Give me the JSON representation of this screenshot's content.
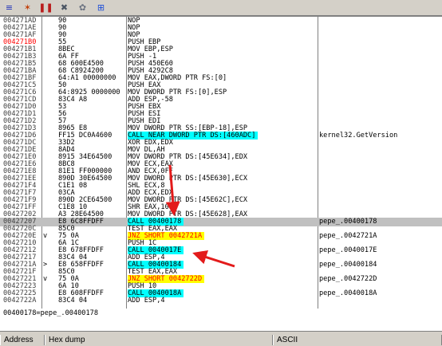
{
  "toolbar": {
    "icons": [
      {
        "name": "list-icon",
        "glyph": "≡",
        "color": "#1d2fb8"
      },
      {
        "name": "flame-icon",
        "glyph": "✶",
        "color": "#c2410c"
      },
      {
        "name": "bars-icon",
        "glyph": "❚❚",
        "color": "#b91c1c"
      },
      {
        "name": "crossed-tools-icon",
        "glyph": "✖",
        "color": "#4b5563"
      },
      {
        "name": "gear-icon",
        "glyph": "✿",
        "color": "#6b7280"
      },
      {
        "name": "network-icon",
        "glyph": "⊞",
        "color": "#1d4ed8"
      }
    ]
  },
  "disasm": {
    "rows": [
      {
        "addr": "004271AD",
        "hex": "90",
        "asm": "NOP",
        "comment": ""
      },
      {
        "addr": "004271AE",
        "hex": "90",
        "asm": "NOP",
        "comment": ""
      },
      {
        "addr": "004271AF",
        "hex": "90",
        "asm": "NOP",
        "comment": ""
      },
      {
        "addr": "004271B0",
        "hex": "55",
        "asm": "PUSH EBP",
        "comment": "",
        "addr_color": "red"
      },
      {
        "addr": "004271B1",
        "hex": "8BEC",
        "asm": "MOV EBP,ESP",
        "comment": ""
      },
      {
        "addr": "004271B3",
        "hex": "6A FF",
        "asm": "PUSH -1",
        "comment": ""
      },
      {
        "addr": "004271B5",
        "hex": "68 600E4500",
        "asm": "PUSH 450E60",
        "comment": ""
      },
      {
        "addr": "004271BA",
        "hex": "68 C8924200",
        "asm": "PUSH 4292C8",
        "comment": ""
      },
      {
        "addr": "004271BF",
        "hex": "64:A1 00000000",
        "asm": "MOV EAX,DWORD PTR FS:[0]",
        "comment": ""
      },
      {
        "addr": "004271C5",
        "hex": "50",
        "asm": "PUSH EAX",
        "comment": ""
      },
      {
        "addr": "004271C6",
        "hex": "64:8925 0000000",
        "asm": "MOV DWORD PTR FS:[0],ESP",
        "comment": ""
      },
      {
        "addr": "004271CD",
        "hex": "83C4 A8",
        "asm": "ADD ESP,-58",
        "comment": ""
      },
      {
        "addr": "004271D0",
        "hex": "53",
        "asm": "PUSH EBX",
        "comment": ""
      },
      {
        "addr": "004271D1",
        "hex": "56",
        "asm": "PUSH ESI",
        "comment": ""
      },
      {
        "addr": "004271D2",
        "hex": "57",
        "asm": "PUSH EDI",
        "comment": ""
      },
      {
        "addr": "004271D3",
        "hex": "8965 E8",
        "asm": "MOV DWORD PTR SS:[EBP-18],ESP",
        "comment": ""
      },
      {
        "addr": "004271D6",
        "hex": "FF15 DC0A4600",
        "asm": "CALL NEAR DWORD PTR DS:[460ADC]",
        "comment": "kernel32.GetVersion",
        "kind": "call"
      },
      {
        "addr": "004271DC",
        "hex": "33D2",
        "asm": "XOR EDX,EDX",
        "comment": ""
      },
      {
        "addr": "004271DE",
        "hex": "8AD4",
        "asm": "MOV DL,AH",
        "comment": ""
      },
      {
        "addr": "004271E0",
        "hex": "8915 34E64500",
        "asm": "MOV DWORD PTR DS:[45E634],EDX",
        "comment": ""
      },
      {
        "addr": "004271E6",
        "hex": "8BC8",
        "asm": "MOV ECX,EAX",
        "comment": ""
      },
      {
        "addr": "004271E8",
        "hex": "81E1 FF000000",
        "asm": "AND ECX,0FF",
        "comment": ""
      },
      {
        "addr": "004271EE",
        "hex": "890D 30E64500",
        "asm": "MOV DWORD PTR DS:[45E630],ECX",
        "comment": ""
      },
      {
        "addr": "004271F4",
        "hex": "C1E1 08",
        "asm": "SHL ECX,8",
        "comment": ""
      },
      {
        "addr": "004271F7",
        "hex": "03CA",
        "asm": "ADD ECX,EDX",
        "comment": ""
      },
      {
        "addr": "004271F9",
        "hex": "890D 2CE64500",
        "asm": "MOV DWORD PTR DS:[45E62C],ECX",
        "comment": ""
      },
      {
        "addr": "004271FF",
        "hex": "C1E8 10",
        "asm": "SHR EAX,10",
        "comment": ""
      },
      {
        "addr": "00427202",
        "hex": "A3 28E64500",
        "asm": "MOV DWORD PTR DS:[45E628],EAX",
        "comment": ""
      },
      {
        "addr": "00427207",
        "hex": "E8 6C8FFDFF",
        "asm": "CALL 00400178",
        "comment": "pepe_.00400178",
        "kind": "call",
        "selected": true
      },
      {
        "addr": "0042720C",
        "hex": "85C0",
        "asm": "TEST EAX,EAX",
        "comment": ""
      },
      {
        "addr": "0042720E",
        "hex": "75 0A",
        "asm": "JNZ SHORT 0042721A",
        "comment": "pepe_.0042721A",
        "kind": "jmp",
        "tick": "v"
      },
      {
        "addr": "00427210",
        "hex": "6A 1C",
        "asm": "PUSH 1C",
        "comment": ""
      },
      {
        "addr": "00427212",
        "hex": "E8 678FFDFF",
        "asm": "CALL 0040017E",
        "comment": "pepe_.0040017E",
        "kind": "call"
      },
      {
        "addr": "00427217",
        "hex": "83C4 04",
        "asm": "ADD ESP,4",
        "comment": ""
      },
      {
        "addr": "0042721A",
        "hex": "E8 658FFDFF",
        "asm": "CALL 00400184",
        "comment": "pepe_.00400184",
        "kind": "call",
        "tick": ">"
      },
      {
        "addr": "0042721F",
        "hex": "85C0",
        "asm": "TEST EAX,EAX",
        "comment": ""
      },
      {
        "addr": "00427221",
        "hex": "75 0A",
        "asm": "JNZ SHORT 0042722D",
        "comment": "pepe_.0042722D",
        "kind": "jmp",
        "tick": "v"
      },
      {
        "addr": "00427223",
        "hex": "6A 10",
        "asm": "PUSH 10",
        "comment": ""
      },
      {
        "addr": "00427225",
        "hex": "E8 608FFDFF",
        "asm": "CALL 0040018A",
        "comment": "pepe_.0040018A",
        "kind": "call"
      },
      {
        "addr": "0042722A",
        "hex": "83C4 04",
        "asm": "ADD ESP,4",
        "comment": ""
      }
    ]
  },
  "info": {
    "text": "00400178=pepe_.00400178"
  },
  "dump": {
    "headers": [
      "Address",
      "Hex dump",
      "ASCII"
    ]
  }
}
